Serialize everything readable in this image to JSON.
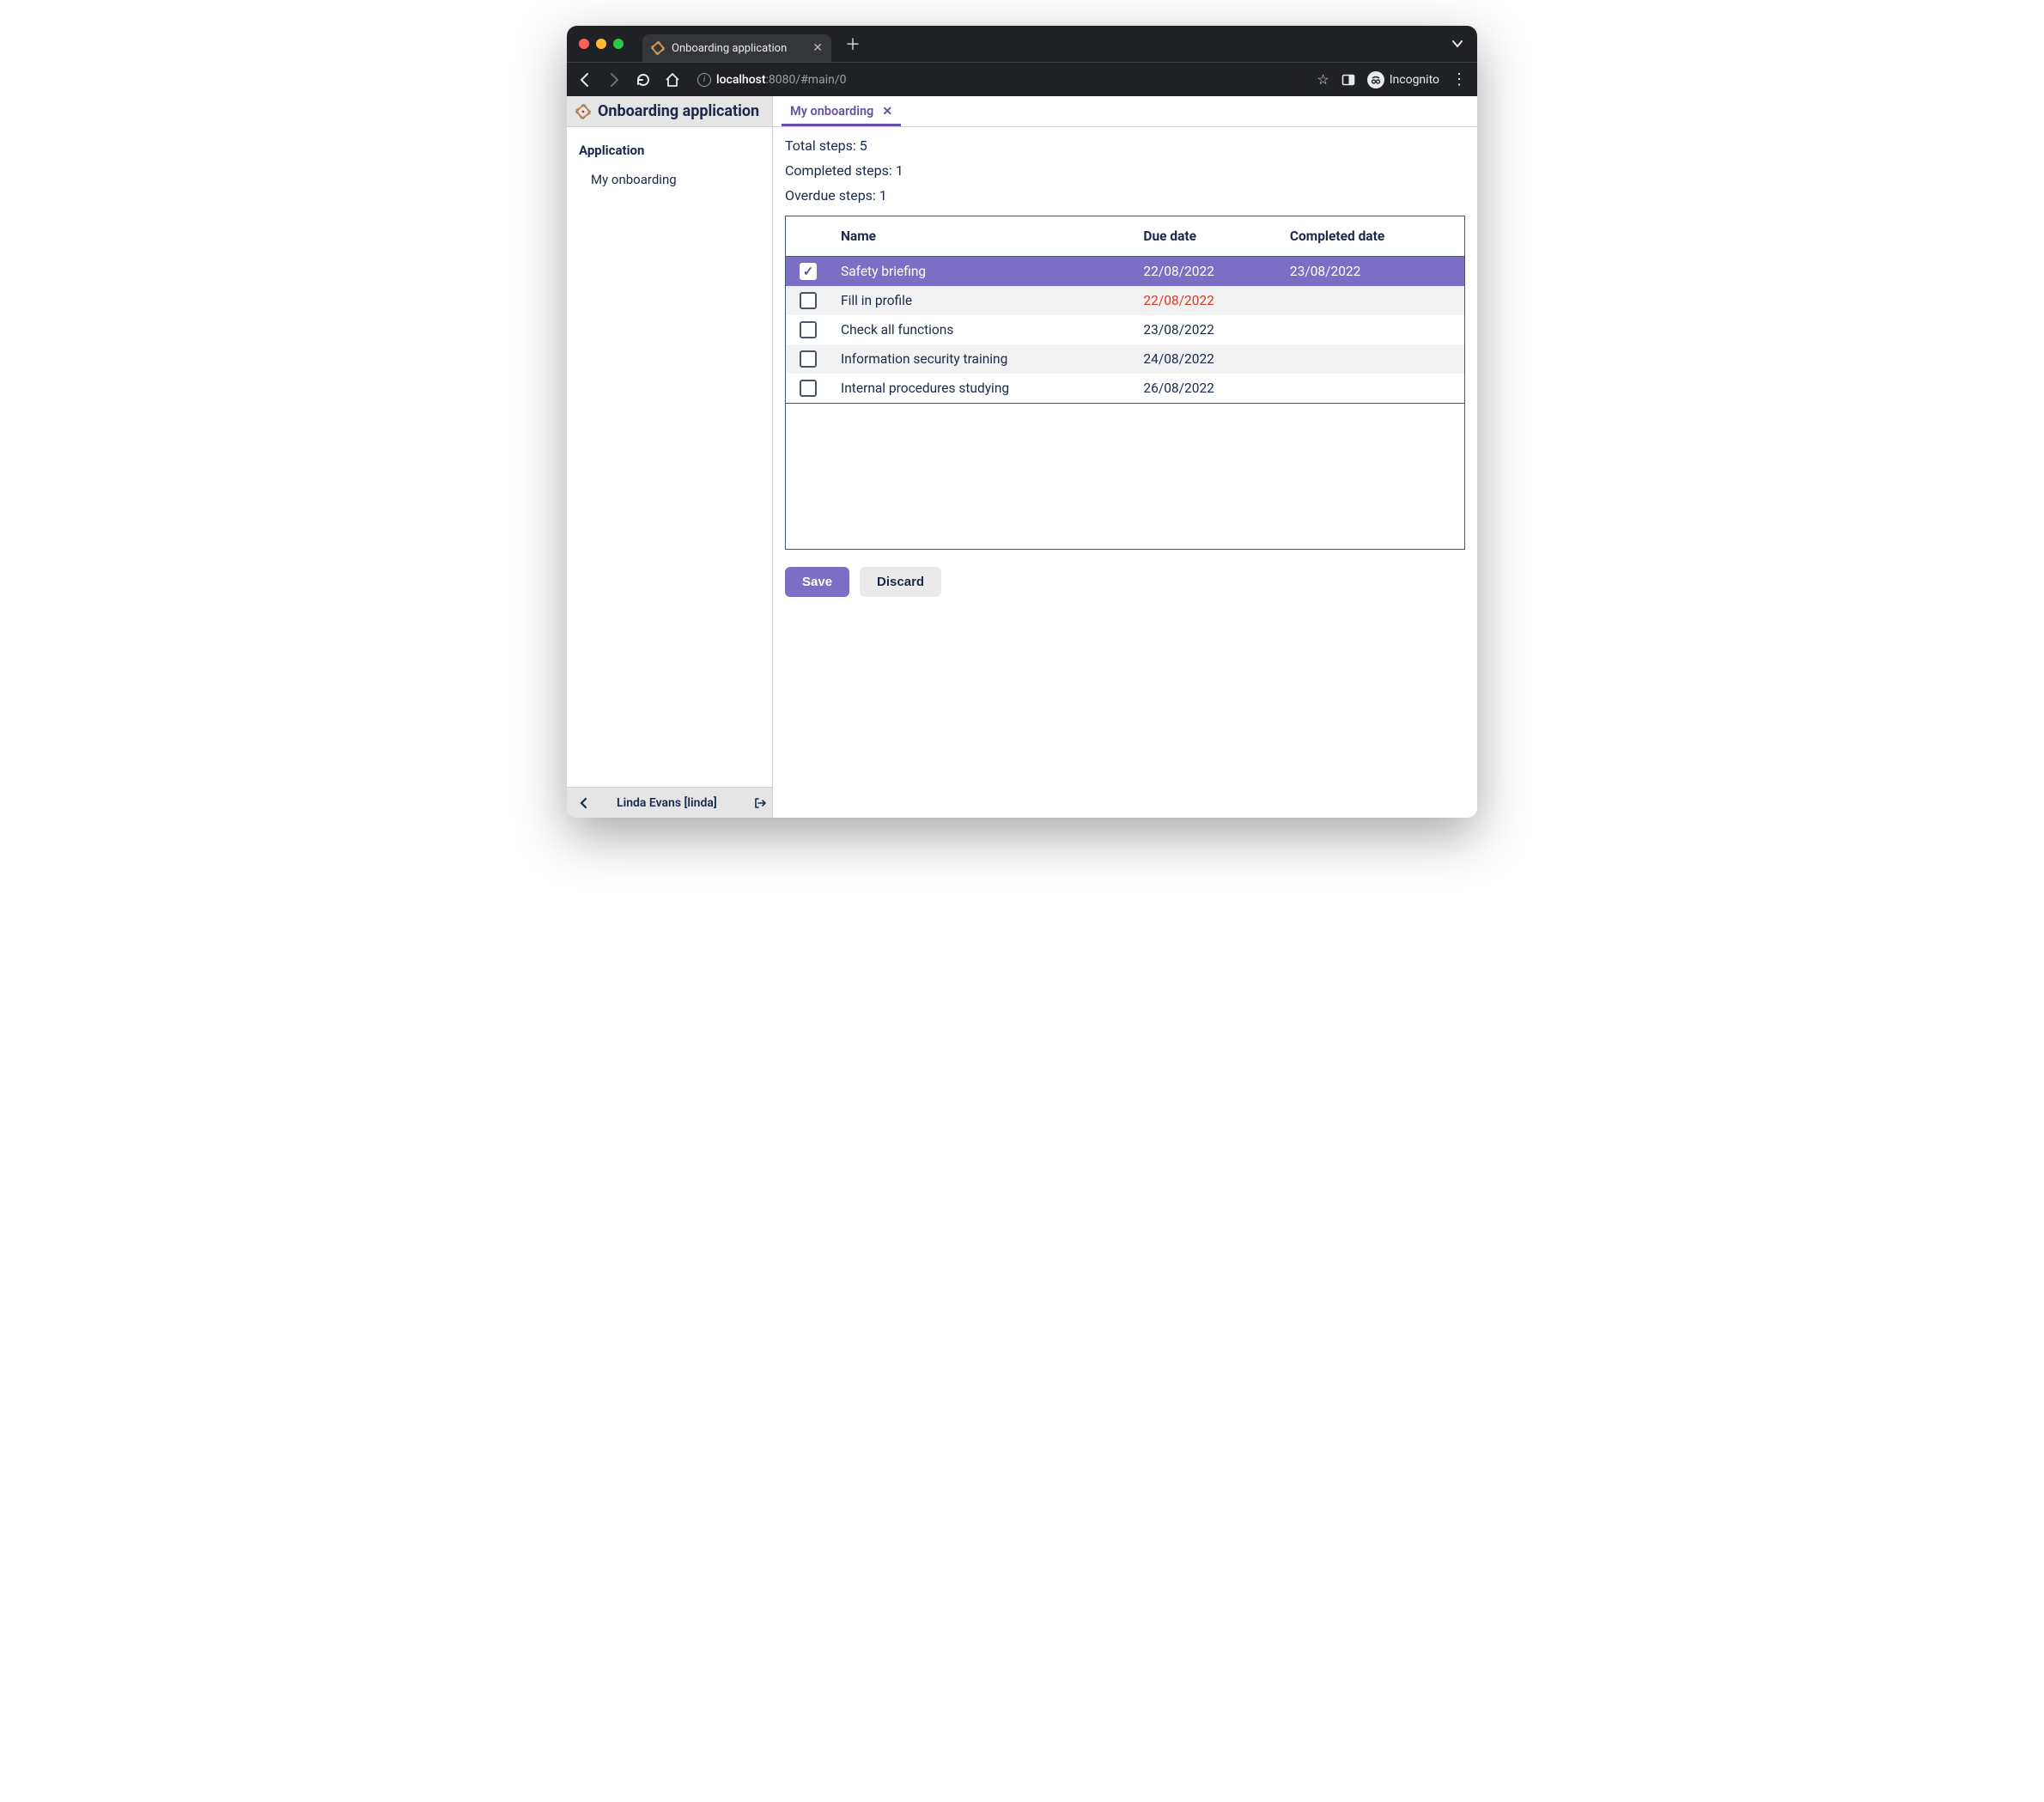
{
  "browser": {
    "tab_title": "Onboarding application",
    "url_host": "localhost",
    "url_port": ":8080",
    "url_path": "/#main/0",
    "incognito_label": "Incognito"
  },
  "sidebar": {
    "app_title": "Onboarding application",
    "group_label": "Application",
    "items": [
      {
        "label": "My onboarding"
      }
    ],
    "footer_user": "Linda Evans [linda]"
  },
  "main": {
    "tab_label": "My onboarding",
    "stats": {
      "total_label": "Total steps: 5",
      "completed_label": "Completed steps: 1",
      "overdue_label": "Overdue steps: 1"
    },
    "columns": {
      "name": "Name",
      "due": "Due date",
      "completed": "Completed date"
    },
    "rows": [
      {
        "checked": true,
        "selected": true,
        "name": "Safety briefing",
        "due": "22/08/2022",
        "completed": "23/08/2022",
        "overdue": false
      },
      {
        "checked": false,
        "selected": false,
        "name": "Fill in profile",
        "due": "22/08/2022",
        "completed": "",
        "overdue": true
      },
      {
        "checked": false,
        "selected": false,
        "name": "Check all functions",
        "due": "23/08/2022",
        "completed": "",
        "overdue": false
      },
      {
        "checked": false,
        "selected": false,
        "name": "Information security training",
        "due": "24/08/2022",
        "completed": "",
        "overdue": false
      },
      {
        "checked": false,
        "selected": false,
        "name": "Internal procedures studying",
        "due": "26/08/2022",
        "completed": "",
        "overdue": false
      }
    ],
    "buttons": {
      "save": "Save",
      "discard": "Discard"
    }
  }
}
